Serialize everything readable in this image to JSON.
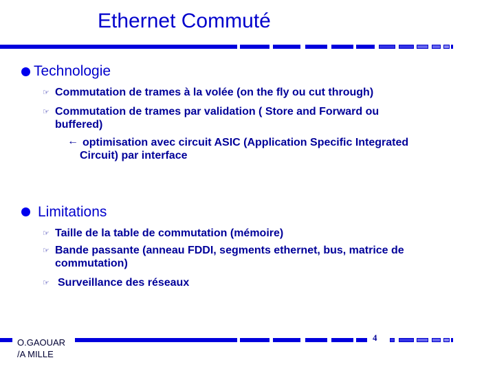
{
  "slide": {
    "title": "Ethernet Commuté",
    "sections": [
      {
        "heading": "Technologie",
        "items": [
          {
            "icon": "pointing-hand-icon",
            "text": "Commutation de trames à la volée  (on the fly ou cut through)"
          },
          {
            "icon": "pointing-hand-icon",
            "text_line1": "Commutation de trames par validation ( Store and Forward ou",
            "text_line2": "buffered)",
            "subitem": {
              "icon": "left-arrow-icon",
              "text_line1": "optimisation avec circuit ASIC (Application Specific Integrated",
              "text_line2": "Circuit) par interface"
            }
          }
        ]
      },
      {
        "heading": "Limitations",
        "items": [
          {
            "icon": "pointing-hand-icon",
            "text": "Taille de la table de commutation (mémoire)"
          },
          {
            "icon": "pointing-hand-icon",
            "text_line1": "Bande passante (anneau FDDI, segments ethernet, bus, matrice de",
            "text_line2": "commutation)"
          },
          {
            "icon": "pointing-hand-icon",
            "text": "Surveillance des réseaux"
          }
        ]
      }
    ],
    "footer": {
      "author_line1": "O.GAOUAR",
      "author_line2": "/A MILLE",
      "page_number": "4"
    },
    "glyphs": {
      "hand": "☞",
      "arrow": "←"
    }
  }
}
